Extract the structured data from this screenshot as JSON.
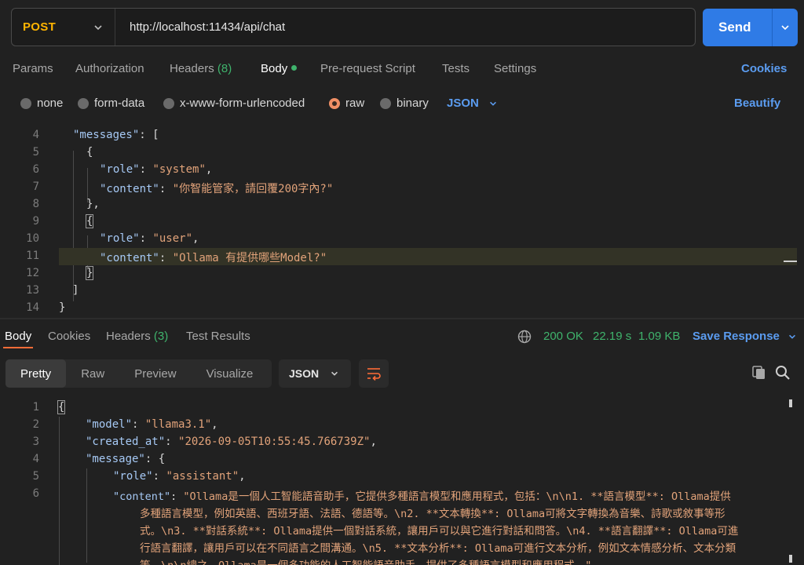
{
  "request": {
    "method": "POST",
    "url": "http://localhost:11434/api/chat",
    "send_label": "Send"
  },
  "request_tabs": [
    {
      "label": "Params"
    },
    {
      "label": "Authorization"
    },
    {
      "label": "Headers",
      "count": "(8)"
    },
    {
      "label": "Body"
    },
    {
      "label": "Pre-request Script"
    },
    {
      "label": "Tests"
    },
    {
      "label": "Settings"
    }
  ],
  "cookies_label": "Cookies",
  "body_types": [
    {
      "label": "none"
    },
    {
      "label": "form-data"
    },
    {
      "label": "x-www-form-urlencoded"
    },
    {
      "label": "raw",
      "selected": true
    },
    {
      "label": "binary"
    }
  ],
  "body_language": "JSON",
  "beautify_label": "Beautify",
  "request_body_lines": [
    {
      "n": "4",
      "key": "\"messages\"",
      "rest": ": ["
    },
    {
      "n": "5",
      "text": "{"
    },
    {
      "n": "6",
      "key": "\"role\"",
      "sep": ": ",
      "val": "\"system\"",
      "end": ","
    },
    {
      "n": "7",
      "key": "\"content\"",
      "sep": ": ",
      "val": "\"你智能管家，請回覆200字內?\"",
      "end": ""
    },
    {
      "n": "8",
      "text": "},"
    },
    {
      "n": "9",
      "text": "{"
    },
    {
      "n": "10",
      "key": "\"role\"",
      "sep": ": ",
      "val": "\"user\"",
      "end": ","
    },
    {
      "n": "11",
      "key": "\"content\"",
      "sep": ": ",
      "val": "\"Ollama 有提供哪些Model?\"",
      "end": ""
    },
    {
      "n": "12",
      "text": "}"
    },
    {
      "n": "13",
      "text": "]"
    },
    {
      "n": "14",
      "text": "}"
    }
  ],
  "response_tabs": [
    {
      "label": "Body"
    },
    {
      "label": "Cookies"
    },
    {
      "label": "Headers",
      "count": "(3)"
    },
    {
      "label": "Test Results"
    }
  ],
  "response_status": {
    "status": "200 OK",
    "time": "22.19 s",
    "size": "1.09 KB"
  },
  "save_response_label": "Save Response",
  "view_tabs": [
    {
      "label": "Pretty"
    },
    {
      "label": "Raw"
    },
    {
      "label": "Preview"
    },
    {
      "label": "Visualize"
    }
  ],
  "response_language": "JSON",
  "response_lines": [
    {
      "n": "1",
      "text": "{"
    },
    {
      "n": "2",
      "key": "\"model\"",
      "sep": ": ",
      "val": "\"llama3.1\"",
      "end": ","
    },
    {
      "n": "3",
      "key": "\"created_at\"",
      "sep": ": ",
      "val": "\"2026-09-05T10:55:45.766739Z\"",
      "end": ","
    },
    {
      "n": "4",
      "key": "\"message\"",
      "rest": ": {"
    },
    {
      "n": "5",
      "key": "\"role\"",
      "sep": ": ",
      "val": "\"assistant\"",
      "end": ","
    },
    {
      "n": "6",
      "key": "\"content\"",
      "sep": ": ",
      "val": "\"Ollama是一個人工智能語音助手，它提供多種語言模型和應用程式，包括：\\n\\n1. **語言模型**: Ollama提供"
    }
  ],
  "content_continuation": [
    "多種語言模型，例如英語、西班牙語、法語、德語等。\\n2. **文本轉換**: Ollama可將文字轉換為音樂、詩歌或敘事等形",
    "式。\\n3. **對話系統**: Ollama提供一個對話系統，讓用戶可以與它進行對話和問答。\\n4. **語言翻譯**: Ollama可進",
    "行語言翻譯，讓用戶可以在不同語言之間溝通。\\n5. **文本分析**: Ollama可進行文本分析，例如文本情感分析、文本分類",
    "等。\\n\\n總之，Ollama是一個多功能的人工智能語音助手，提供了多種語言模型和應用程式。\""
  ],
  "colors": {
    "accent_blue": "#2f7be6",
    "method_orange": "#ffb400",
    "status_green": "#3fb36c",
    "json_key": "#a6c9f5",
    "json_string": "#e2a37a"
  }
}
